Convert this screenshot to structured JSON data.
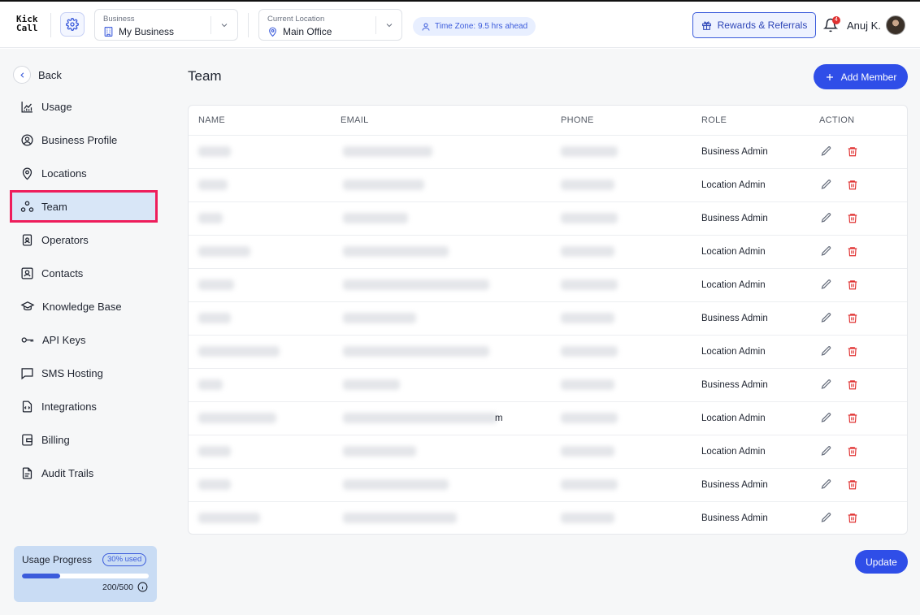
{
  "header": {
    "logo": "Kick\nCall",
    "business": {
      "label": "Business",
      "value": "My Business"
    },
    "location": {
      "label": "Current Location",
      "value": "Main Office"
    },
    "timezone": "Time Zone: 9.5 hrs ahead",
    "rewards_label": "Rewards & Referrals",
    "notification_count": "4",
    "user_name": "Anuj K."
  },
  "sidebar": {
    "back_label": "Back",
    "items": [
      {
        "label": "Usage",
        "icon": "chart-icon"
      },
      {
        "label": "Business Profile",
        "icon": "user-circle-icon"
      },
      {
        "label": "Locations",
        "icon": "map-pin-icon"
      },
      {
        "label": "Team",
        "icon": "team-icon",
        "active": true
      },
      {
        "label": "Operators",
        "icon": "operator-badge-icon"
      },
      {
        "label": "Contacts",
        "icon": "contacts-icon"
      },
      {
        "label": "Knowledge Base",
        "icon": "graduation-cap-icon"
      },
      {
        "label": "API Keys",
        "icon": "key-icon"
      },
      {
        "label": "SMS Hosting",
        "icon": "message-icon"
      },
      {
        "label": "Integrations",
        "icon": "code-file-icon"
      },
      {
        "label": "Billing",
        "icon": "wallet-icon"
      },
      {
        "label": "Audit Trails",
        "icon": "document-icon"
      }
    ],
    "usage": {
      "title": "Usage Progress",
      "pill": "30% used",
      "progress": 0.3,
      "count": "200/500"
    }
  },
  "main": {
    "title": "Team",
    "add_label": "Add Member",
    "update_label": "Update",
    "columns": [
      "NAME",
      "EMAIL",
      "PHONE",
      "ROLE",
      "ACTION"
    ],
    "rows": [
      {
        "role": "Business Admin"
      },
      {
        "role": "Location Admin"
      },
      {
        "role": "Business Admin"
      },
      {
        "role": "Location Admin"
      },
      {
        "role": "Location Admin"
      },
      {
        "role": "Business Admin"
      },
      {
        "role": "Location Admin"
      },
      {
        "role": "Business Admin"
      },
      {
        "role": "Location Admin",
        "email_tail": "m"
      },
      {
        "role": "Location Admin"
      },
      {
        "role": "Business Admin"
      },
      {
        "role": "Business Admin"
      }
    ]
  },
  "colors": {
    "accent": "#2f4ee8",
    "active_nav_bg": "#d8e6f7",
    "highlight_border": "#ee1d5b",
    "delete_red": "#e03131"
  }
}
